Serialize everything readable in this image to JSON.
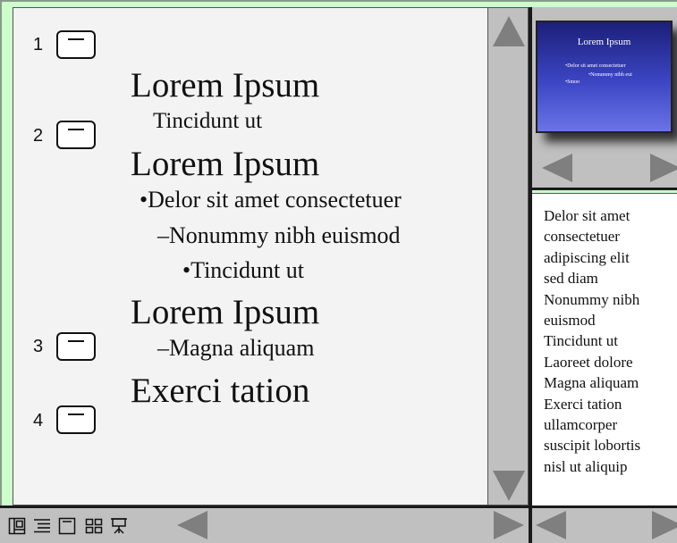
{
  "outline": {
    "slides": [
      {
        "number": "1"
      },
      {
        "number": "2"
      },
      {
        "number": "3"
      },
      {
        "number": "4"
      }
    ],
    "lines": [
      {
        "text": "Lorem Ipsum"
      },
      {
        "text": "Tincidunt ut"
      },
      {
        "text": "Lorem Ipsum"
      },
      {
        "text": "•Delor sit amet consectetuer"
      },
      {
        "text": "–Nonummy nibh euismod"
      },
      {
        "text": "•Tincidunt ut"
      },
      {
        "text": "Lorem Ipsum"
      },
      {
        "text": "–Magna aliquam"
      },
      {
        "text": "Exerci tation"
      }
    ]
  },
  "thumbnail": {
    "title": "Lorem Ipsum",
    "bullets": [
      "•Delor sit amet consectetuer",
      "•Nonummy nibh eui",
      "•Smoo"
    ]
  },
  "notes": [
    "Delor sit amet",
    "consectetuer",
    "adipiscing elit",
    "sed diam",
    "Nonummy nibh",
    "euismod",
    "Tincidunt ut",
    "Laoreet dolore",
    "Magna aliquam",
    "Exerci tation",
    "ullamcorper",
    "suscipit lobortis",
    "nisl ut aliquip"
  ],
  "view_buttons": [
    {
      "icon": "normal-view-icon"
    },
    {
      "icon": "outline-view-icon"
    },
    {
      "icon": "slide-view-icon"
    },
    {
      "icon": "slide-sorter-icon"
    },
    {
      "icon": "slide-show-icon"
    }
  ],
  "colors": {
    "window_bg": "#ccffcc",
    "pane_bg": "#f3f3f3",
    "scrollbar": "#c0c0c0",
    "arrow": "#7f7f7f",
    "thumb_top": "#1c1f7a",
    "thumb_bottom": "#6a74e6"
  }
}
